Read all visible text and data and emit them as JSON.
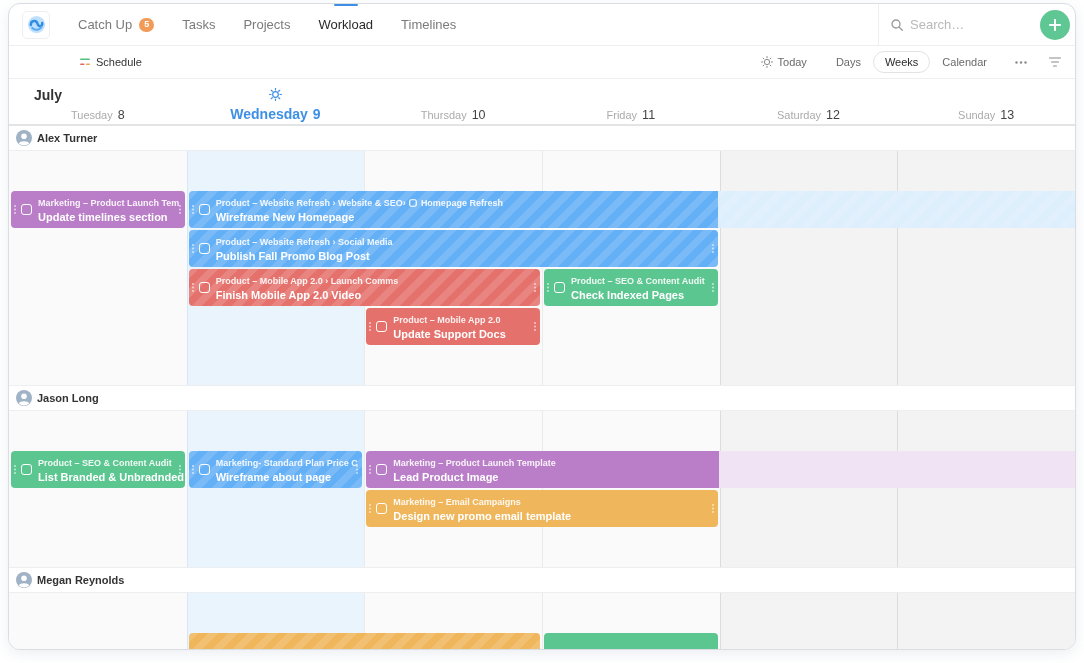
{
  "nav": {
    "tabs": [
      {
        "label": "Catch Up",
        "badge": "5",
        "selected": false
      },
      {
        "label": "Tasks",
        "selected": false
      },
      {
        "label": "Projects",
        "selected": false
      },
      {
        "label": "Workload",
        "selected": true
      },
      {
        "label": "Timelines",
        "selected": false
      }
    ],
    "search": {
      "placeholder": "Search…"
    }
  },
  "toolbar": {
    "title": "Schedule",
    "today": "Today",
    "views": [
      {
        "label": "Days",
        "selected": false
      },
      {
        "label": "Weeks",
        "selected": true
      },
      {
        "label": "Calendar",
        "selected": false
      }
    ]
  },
  "calendar": {
    "month": "July",
    "days": [
      {
        "name": "Tuesday",
        "number": "8",
        "today": false,
        "weekend": false
      },
      {
        "name": "Wednesday",
        "number": "9",
        "today": true,
        "weekend": false
      },
      {
        "name": "Thursday",
        "number": "10",
        "today": false,
        "weekend": false
      },
      {
        "name": "Friday",
        "number": "11",
        "today": false,
        "weekend": false
      },
      {
        "name": "Saturday",
        "number": "12",
        "today": false,
        "weekend": true
      },
      {
        "name": "Sunday",
        "number": "13",
        "today": false,
        "weekend": true
      }
    ],
    "people": [
      {
        "name": "Alex Turner",
        "lanes": [
          [
            {
              "kind": "task",
              "path": "Marketing – Product Launch Tem",
              "title": "Update timelines section",
              "color": "#b97ec7",
              "striped": false,
              "checked": false
            },
            {
              "kind": "task",
              "path": "Product – Website Refresh › Website & SEO›",
              "subtask": "Homepage Refresh",
              "title": "Wireframe New Homepage",
              "color": "#64b0f6",
              "striped": true,
              "checked": false
            },
            {
              "kind": "continued"
            },
            {
              "kind": "continued"
            },
            {
              "kind": "continued"
            },
            {
              "kind": "continued"
            }
          ],
          [
            {
              "kind": "empty"
            },
            {
              "kind": "task",
              "path": "Product – Website Refresh › Social Media",
              "title": "Publish Fall Promo Blog Post",
              "color": "#64b0f6",
              "striped": true,
              "checked": false
            },
            {
              "kind": "continued"
            },
            {
              "kind": "continued"
            },
            {
              "kind": "empty"
            },
            {
              "kind": "empty"
            }
          ],
          [
            {
              "kind": "empty"
            },
            {
              "kind": "task",
              "path": "Product – Mobile App 2.0 › Launch Comms",
              "title": "Finish Mobile App 2.0 Video",
              "color": "#e5716c",
              "striped": true,
              "checked": false
            },
            {
              "kind": "continued"
            },
            {
              "kind": "task",
              "path": "Product – SEO & Content Audit",
              "title": "Check Indexed Pages",
              "color": "#5cc691",
              "striped": false,
              "checked": false
            },
            {
              "kind": "empty"
            },
            {
              "kind": "empty"
            }
          ],
          [
            {
              "kind": "empty"
            },
            {
              "kind": "empty"
            },
            {
              "kind": "task",
              "path": "Product – Mobile App 2.0",
              "title": "Update Support Docs",
              "color": "#e5716c",
              "striped": false,
              "checked": false
            },
            {
              "kind": "empty"
            },
            {
              "kind": "empty"
            },
            {
              "kind": "empty"
            }
          ]
        ]
      },
      {
        "name": "Jason Long",
        "lanes": [
          [
            {
              "kind": "task",
              "path": "Product – SEO & Content Audit",
              "title": "List Branded & Unbradnded",
              "color": "#5cc691",
              "striped": false,
              "checked": false
            },
            {
              "kind": "task",
              "path": "Marketing- Standard Plan Price C",
              "title": "Wireframe about page",
              "color": "#64b0f6",
              "striped": true,
              "checked": false
            },
            {
              "kind": "task",
              "path": "Marketing – Product Launch Template",
              "title": "Lead Product Image",
              "color": "#b97ec7",
              "striped": false,
              "checked": false
            },
            {
              "kind": "continued"
            },
            {
              "kind": "continued"
            },
            {
              "kind": "continued"
            }
          ],
          [
            {
              "kind": "empty"
            },
            {
              "kind": "empty"
            },
            {
              "kind": "task",
              "path": "Marketing – Email Campaigns",
              "title": "Design new promo email template",
              "color": "#efb65b",
              "striped": false,
              "checked": false
            },
            {
              "kind": "continued"
            },
            {
              "kind": "empty"
            },
            {
              "kind": "empty"
            }
          ]
        ]
      },
      {
        "name": "Megan Reynolds",
        "lanes": [
          [
            {
              "kind": "empty"
            },
            {
              "kind": "task",
              "color": "#efb65b",
              "striped": true
            },
            {
              "kind": "continued"
            },
            {
              "kind": "task",
              "color": "#5cc691",
              "striped": false
            },
            {
              "kind": "empty"
            },
            {
              "kind": "empty"
            }
          ]
        ]
      }
    ]
  }
}
